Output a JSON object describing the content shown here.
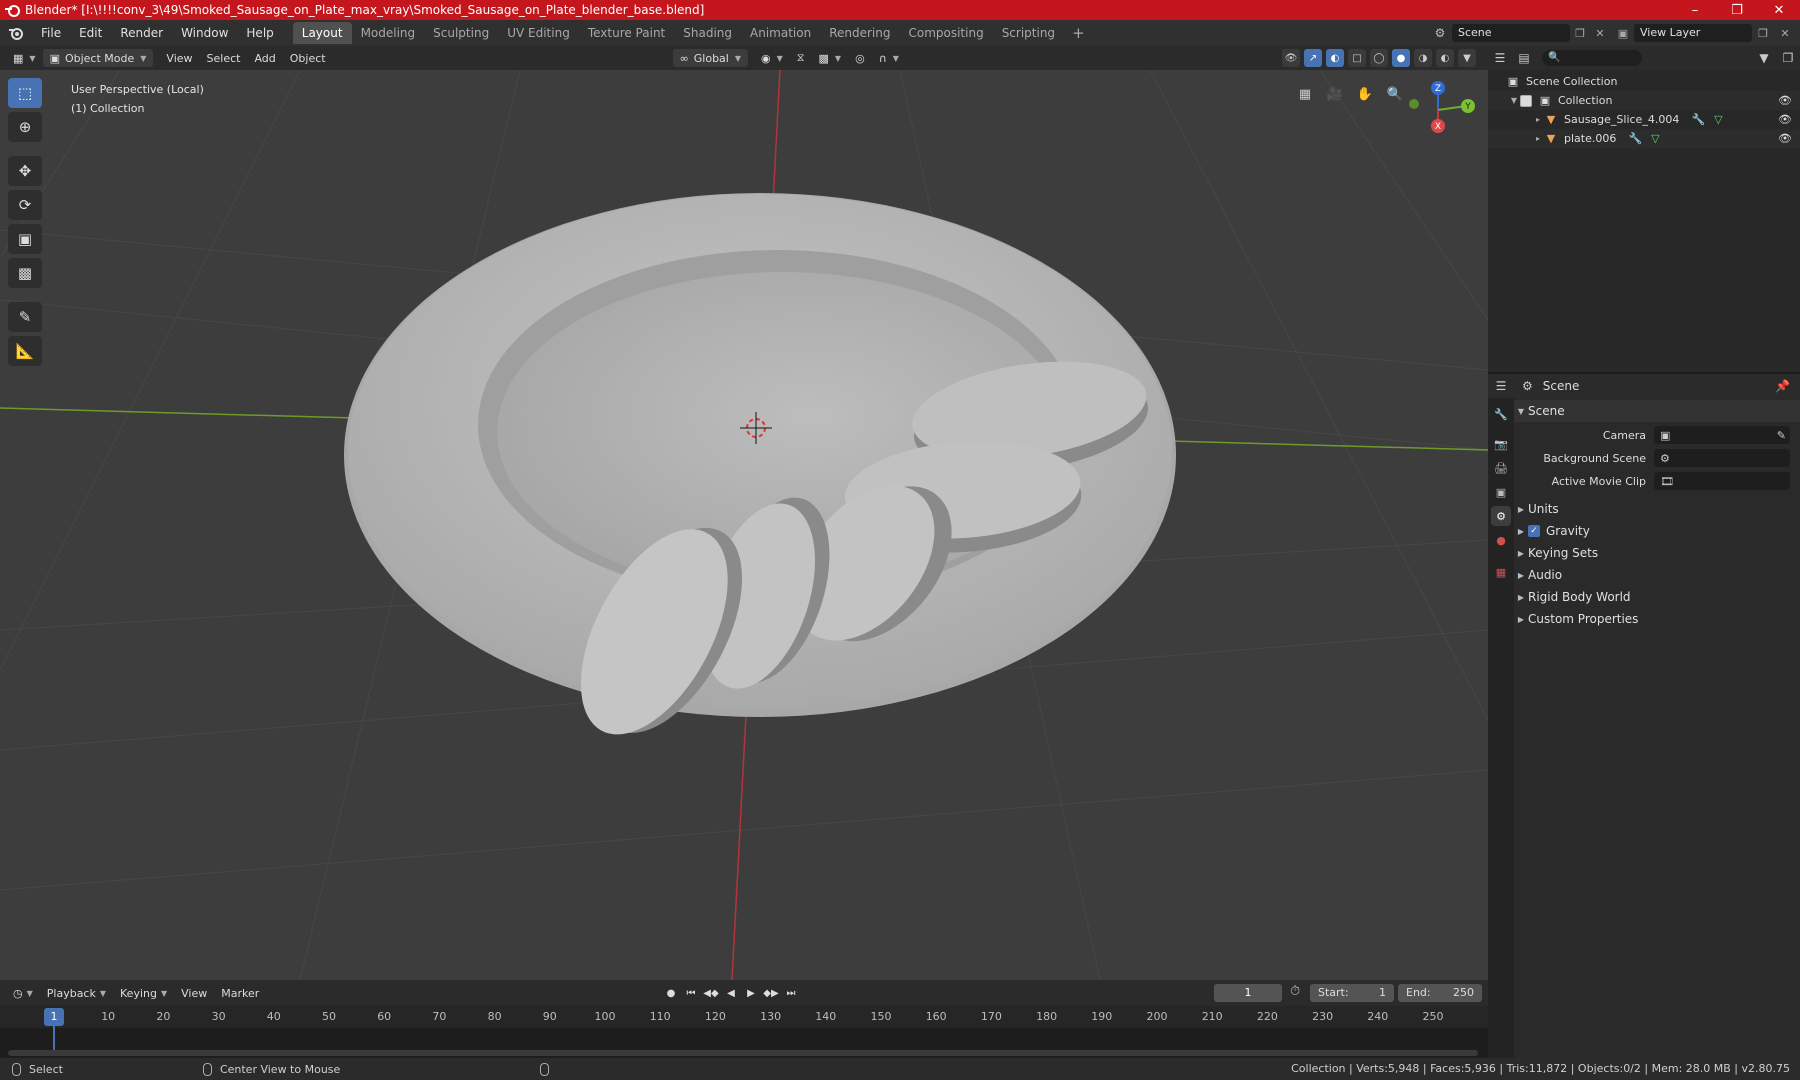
{
  "window": {
    "title": "Blender* [I:\\!!!!conv_3\\49\\Smoked_Sausage_on_Plate_max_vray\\Smoked_Sausage_on_Plate_blender_base.blend]",
    "controls": [
      "minimize",
      "maximize",
      "close"
    ]
  },
  "menu": {
    "items": [
      "File",
      "Edit",
      "Render",
      "Window",
      "Help"
    ],
    "workspaces": [
      "Layout",
      "Modeling",
      "Sculpting",
      "UV Editing",
      "Texture Paint",
      "Shading",
      "Animation",
      "Rendering",
      "Compositing",
      "Scripting"
    ],
    "active_workspace": "Layout",
    "add_label": "+",
    "scene": "Scene",
    "view_layer": "View Layer"
  },
  "viewport_header": {
    "mode": "Object Mode",
    "menus": [
      "View",
      "Select",
      "Add",
      "Object"
    ],
    "orientation": "Global"
  },
  "viewport": {
    "perspective": "User Perspective (Local)",
    "collection": "(1) Collection",
    "gizmo_axes": {
      "x": "X",
      "y": "Y",
      "z": "Z"
    },
    "colors": {
      "background": "#3d3d3d",
      "grid": "#484848",
      "x_axis": "#b3343a",
      "y_axis": "#6e9a2a",
      "mesh": "#b8b8b8"
    }
  },
  "tools": [
    "select-box",
    "cursor",
    "move",
    "rotate",
    "scale",
    "transform",
    "annotate",
    "measure"
  ],
  "timeline": {
    "menus": [
      "Playback",
      "Keying",
      "View",
      "Marker"
    ],
    "current_frame": "1",
    "start_label": "Start:",
    "start": "1",
    "end_label": "End:",
    "end": "250",
    "ticks": [
      "10",
      "20",
      "30",
      "40",
      "50",
      "60",
      "70",
      "80",
      "90",
      "100",
      "110",
      "120",
      "130",
      "140",
      "150",
      "160",
      "170",
      "180",
      "190",
      "200",
      "210",
      "220",
      "230",
      "240",
      "250"
    ],
    "cursor_label": "1"
  },
  "statusbar": {
    "left": "Select",
    "middle": "Center View to Mouse",
    "stats": "Collection | Verts:5,948 | Faces:5,936 | Tris:11,872 | Objects:0/2 | Mem: 28.0 MB | v2.80.75"
  },
  "outliner": {
    "root": "Scene Collection",
    "collection": "Collection",
    "objects": [
      "Sausage_Slice_4.004",
      "plate.006"
    ]
  },
  "properties": {
    "context": "Scene",
    "panel": "Scene",
    "camera_label": "Camera",
    "background_label": "Background Scene",
    "movie_clip_label": "Active Movie Clip",
    "sections": [
      "Units",
      "Gravity",
      "Keying Sets",
      "Audio",
      "Rigid Body World",
      "Custom Properties"
    ],
    "gravity_checked": true
  }
}
